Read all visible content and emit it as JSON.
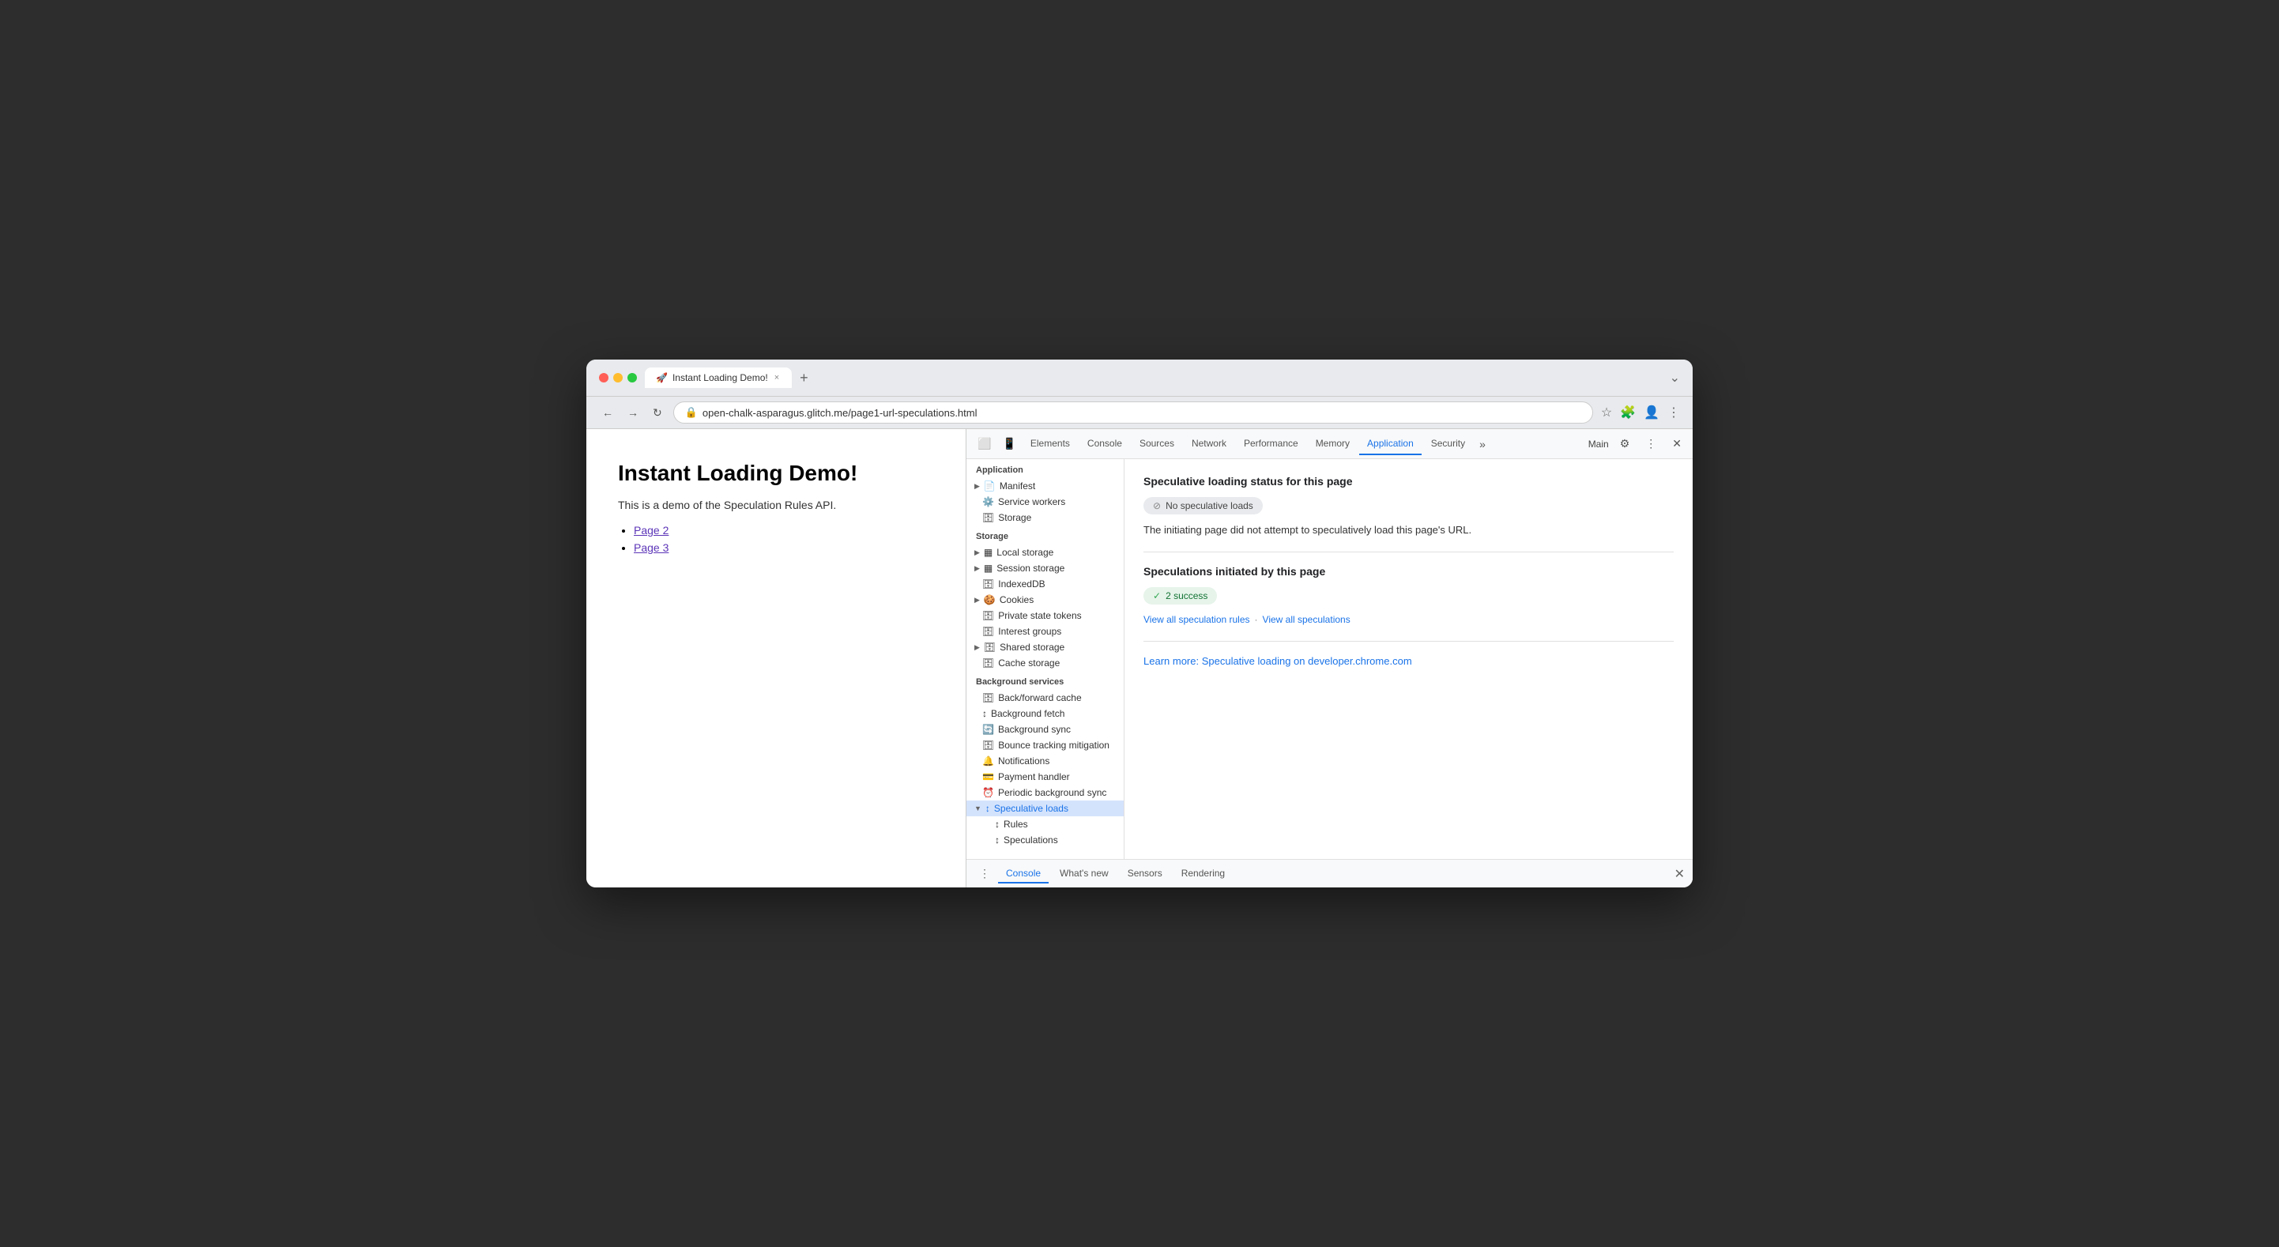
{
  "browser": {
    "tab_title": "Instant Loading Demo!",
    "tab_icon": "🚀",
    "tab_close": "×",
    "tab_new": "+",
    "address": "open-chalk-asparagus.glitch.me/page1-url-speculations.html",
    "nav_back": "←",
    "nav_forward": "→",
    "nav_reload": "↻",
    "address_icon": "🔒"
  },
  "page": {
    "title": "Instant Loading Demo!",
    "subtitle": "This is a demo of the Speculation Rules API.",
    "links": [
      "Page 2",
      "Page 3"
    ]
  },
  "devtools": {
    "tabs": [
      {
        "label": "Elements",
        "active": false
      },
      {
        "label": "Console",
        "active": false
      },
      {
        "label": "Sources",
        "active": false
      },
      {
        "label": "Network",
        "active": false
      },
      {
        "label": "Performance",
        "active": false
      },
      {
        "label": "Memory",
        "active": false
      },
      {
        "label": "Application",
        "active": true
      },
      {
        "label": "Security",
        "active": false
      }
    ],
    "context_label": "Main",
    "sidebar": {
      "application_section": "Application",
      "application_items": [
        {
          "label": "Manifest",
          "icon": "📄",
          "has_arrow": true
        },
        {
          "label": "Service workers",
          "icon": "⚙️"
        },
        {
          "label": "Storage",
          "icon": "🗄️"
        }
      ],
      "storage_section": "Storage",
      "storage_items": [
        {
          "label": "Local storage",
          "icon": "📊",
          "has_arrow": true
        },
        {
          "label": "Session storage",
          "icon": "📊",
          "has_arrow": true
        },
        {
          "label": "IndexedDB",
          "icon": "🗄️"
        },
        {
          "label": "Cookies",
          "icon": "🍪",
          "has_arrow": true
        },
        {
          "label": "Private state tokens",
          "icon": "🗄️"
        },
        {
          "label": "Interest groups",
          "icon": "🗄️"
        },
        {
          "label": "Shared storage",
          "icon": "🗄️",
          "has_arrow": true
        },
        {
          "label": "Cache storage",
          "icon": "🗄️"
        }
      ],
      "background_section": "Background services",
      "background_items": [
        {
          "label": "Back/forward cache",
          "icon": "🗄️"
        },
        {
          "label": "Background fetch",
          "icon": "↕️"
        },
        {
          "label": "Background sync",
          "icon": "🔄"
        },
        {
          "label": "Bounce tracking mitigation",
          "icon": "🗄️"
        },
        {
          "label": "Notifications",
          "icon": "🔔"
        },
        {
          "label": "Payment handler",
          "icon": "💳"
        },
        {
          "label": "Periodic background sync",
          "icon": "⏰"
        },
        {
          "label": "Speculative loads",
          "icon": "↕️",
          "active": true,
          "has_arrow": true,
          "expanded": true
        },
        {
          "label": "Rules",
          "icon": "↕️",
          "indent": true
        },
        {
          "label": "Speculations",
          "icon": "↕️",
          "indent": true
        }
      ]
    },
    "main_panel": {
      "status_section_title": "Speculative loading status for this page",
      "status_badge": "No speculative loads",
      "status_info": "The initiating page did not attempt to speculatively load this page's URL.",
      "speculations_section_title": "Speculations initiated by this page",
      "success_badge": "2 success",
      "view_rules_link": "View all speculation rules",
      "separator": "·",
      "view_speculations_link": "View all speculations",
      "learn_more_link": "Learn more: Speculative loading on developer.chrome.com"
    },
    "console_bar": {
      "tabs": [
        "Console",
        "What's new",
        "Sensors",
        "Rendering"
      ],
      "active_tab": "Console"
    }
  }
}
